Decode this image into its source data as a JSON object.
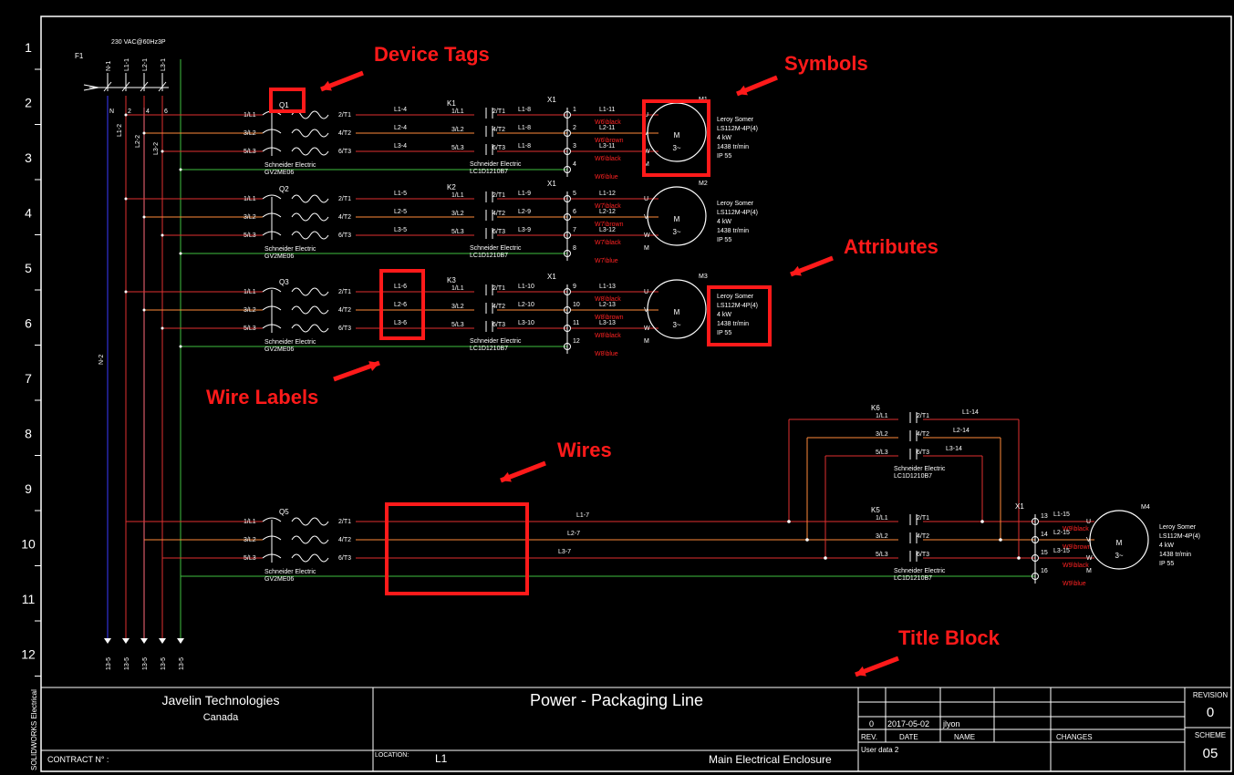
{
  "sheet": {
    "side_label": "SOLIDWORKS Electrical",
    "row_numbers": [
      "1",
      "2",
      "3",
      "4",
      "5",
      "6",
      "7",
      "8",
      "9",
      "10",
      "11",
      "12"
    ],
    "supply": "230 VAC@60Hz3P",
    "fuse_tag": "F1",
    "fuse_wires": [
      "N-1",
      "L1-1",
      "L2-1",
      "L3-1"
    ],
    "fuse_terms": [
      "N",
      "2",
      "4",
      "6"
    ],
    "bus_labels": [
      "L1-2",
      "L2-2",
      "L3-2",
      "N-2"
    ],
    "bottom_labels": [
      "13-5",
      "13-5",
      "13-5",
      "13-5",
      "13-5"
    ]
  },
  "annotations": {
    "device_tags": "Device Tags",
    "symbols": "Symbols",
    "attributes": "Attributes",
    "wire_labels": "Wire Labels",
    "wires": "Wires",
    "title_block": "Title Block"
  },
  "breakers": [
    {
      "tag": "Q1",
      "maker": "Schneider Electric",
      "ref": "GV2ME06",
      "in": [
        "1/L1",
        "3/L2",
        "5/L3"
      ],
      "out": [
        "2/T1",
        "4/T2",
        "6/T3"
      ]
    },
    {
      "tag": "Q2",
      "maker": "Schneider Electric",
      "ref": "GV2ME06",
      "in": [
        "1/L1",
        "3/L2",
        "5/L3"
      ],
      "out": [
        "2/T1",
        "4/T2",
        "6/T3"
      ]
    },
    {
      "tag": "Q3",
      "maker": "Schneider Electric",
      "ref": "GV2ME06",
      "in": [
        "1/L1",
        "3/L2",
        "5/L3"
      ],
      "out": [
        "2/T1",
        "4/T2",
        "6/T3"
      ]
    },
    {
      "tag": "Q5",
      "maker": "Schneider Electric",
      "ref": "GV2ME06",
      "in": [
        "1/L1",
        "3/L2",
        "5/L3"
      ],
      "out": [
        "2/T1",
        "4/T2",
        "6/T3"
      ]
    }
  ],
  "contactors": [
    {
      "tag": "K1",
      "maker": "Schneider Electric",
      "ref": "LC1D1210B7",
      "in": [
        "1/L1",
        "3/L2",
        "5/L3"
      ],
      "out": [
        "2/T1",
        "4/T2",
        "6/T3"
      ]
    },
    {
      "tag": "K2",
      "maker": "Schneider Electric",
      "ref": "LC1D1210B7",
      "in": [
        "1/L1",
        "3/L2",
        "5/L3"
      ],
      "out": [
        "2/T1",
        "4/T2",
        "6/T3"
      ]
    },
    {
      "tag": "K3",
      "maker": "Schneider Electric",
      "ref": "LC1D1210B7",
      "in": [
        "1/L1",
        "3/L2",
        "5/L3"
      ],
      "out": [
        "2/T1",
        "4/T2",
        "6/T3"
      ]
    },
    {
      "tag": "K6",
      "maker": "Schneider Electric",
      "ref": "LC1D1210B7",
      "in": [
        "1/L1",
        "3/L2",
        "5/L3"
      ],
      "out": [
        "2/T1",
        "4/T2",
        "6/T3"
      ]
    },
    {
      "tag": "K5",
      "maker": "Schneider Electric",
      "ref": "LC1D1210B7",
      "in": [
        "1/L1",
        "3/L2",
        "5/L3"
      ],
      "out": [
        "2/T1",
        "4/T2",
        "6/T3"
      ]
    }
  ],
  "wire_labels": {
    "q1_k1": [
      "L1-4",
      "L2-4",
      "L3-4"
    ],
    "k1_x1": [
      "L1-8",
      "L1-8",
      "L1-8"
    ],
    "x1_m1": [
      "L1-11",
      "L2-11",
      "L3-11"
    ],
    "q2_k2": [
      "L1-5",
      "L2-5",
      "L3-5"
    ],
    "k2_x1": [
      "L1-9",
      "L2-9",
      "L3-9"
    ],
    "x1_m2": [
      "L1-12",
      "L2-12",
      "L3-12"
    ],
    "q3_k3": [
      "L1-6",
      "L2-6",
      "L3-6"
    ],
    "k3_x1": [
      "L1-10",
      "L2-10",
      "L3-10"
    ],
    "x1_m3": [
      "L1-13",
      "L2-13",
      "L3-13"
    ],
    "q5_row": [
      "L1-7",
      "L2-7",
      "L3-7"
    ],
    "k6_out": [
      "L1-14",
      "L2-14",
      "L3-14"
    ],
    "x1_m4": [
      "L1-15",
      "L2-15",
      "L3-15"
    ]
  },
  "terminal_tag": "X1",
  "terminals": {
    "m1": [
      "1",
      "2",
      "3",
      "4"
    ],
    "m2": [
      "5",
      "6",
      "7",
      "8"
    ],
    "m3": [
      "9",
      "10",
      "11",
      "12"
    ],
    "m4": [
      "13",
      "14",
      "15",
      "16"
    ]
  },
  "cables": {
    "m1": [
      "W6\\black",
      "W6\\brown",
      "W6\\black",
      "W6\\blue"
    ],
    "m2": [
      "W7\\black",
      "W7\\brown",
      "W7\\black",
      "W7\\blue"
    ],
    "m3": [
      "W8\\black",
      "W8\\brown",
      "W8\\black",
      "W8\\blue"
    ],
    "m4": [
      "W9\\black",
      "W9\\brown",
      "W9\\black",
      "W9\\blue"
    ]
  },
  "motors": [
    {
      "tag": "M1",
      "symbol": "M",
      "phase": "3~",
      "maker": "Leroy Somer",
      "ref": "LS112M-4P(4)",
      "power": "4 kW",
      "speed": "1438 tr/min",
      "ip": "IP 55",
      "terms": [
        "U",
        "V",
        "W",
        "M"
      ]
    },
    {
      "tag": "M2",
      "symbol": "M",
      "phase": "3~",
      "maker": "Leroy Somer",
      "ref": "LS112M-4P(4)",
      "power": "4 kW",
      "speed": "1438 tr/min",
      "ip": "IP 55",
      "terms": [
        "U",
        "V",
        "W",
        "M"
      ]
    },
    {
      "tag": "M3",
      "symbol": "M",
      "phase": "3~",
      "maker": "Leroy Somer",
      "ref": "LS112M-4P(4)",
      "power": "4 kW",
      "speed": "1438 tr/min",
      "ip": "IP 55",
      "terms": [
        "U",
        "V",
        "W",
        "M"
      ]
    },
    {
      "tag": "M4",
      "symbol": "M",
      "phase": "3~",
      "maker": "Leroy Somer",
      "ref": "LS112M-4P(4)",
      "power": "4 kW",
      "speed": "1438 tr/min",
      "ip": "IP 55",
      "terms": [
        "U",
        "V",
        "W",
        "M"
      ]
    }
  ],
  "title_block": {
    "company": "Javelin Technologies",
    "country": "Canada",
    "contract": "CONTRACT N° :",
    "title": "Power - Packaging Line",
    "location_label": "LOCATION:",
    "location_value": "L1",
    "enclosure": "Main Electrical Enclosure",
    "rev_row": [
      "0",
      "2017-05-02",
      "jlyon",
      ""
    ],
    "rev_headers": [
      "REV.",
      "DATE",
      "NAME",
      "CHANGES"
    ],
    "user_data": "User data 2",
    "revision_label": "REVISION",
    "revision_value": "0",
    "scheme_label": "SCHEME",
    "scheme_value": "05"
  },
  "colors": {
    "red_wire": "#e03030",
    "orange_wire": "#ff8a3a",
    "pink_wire": "#ff6a7a",
    "blue_wire": "#3a3aff",
    "green_wire": "#40c040",
    "annotation": "#ff1a1a",
    "cable_text": "#ff2020"
  }
}
